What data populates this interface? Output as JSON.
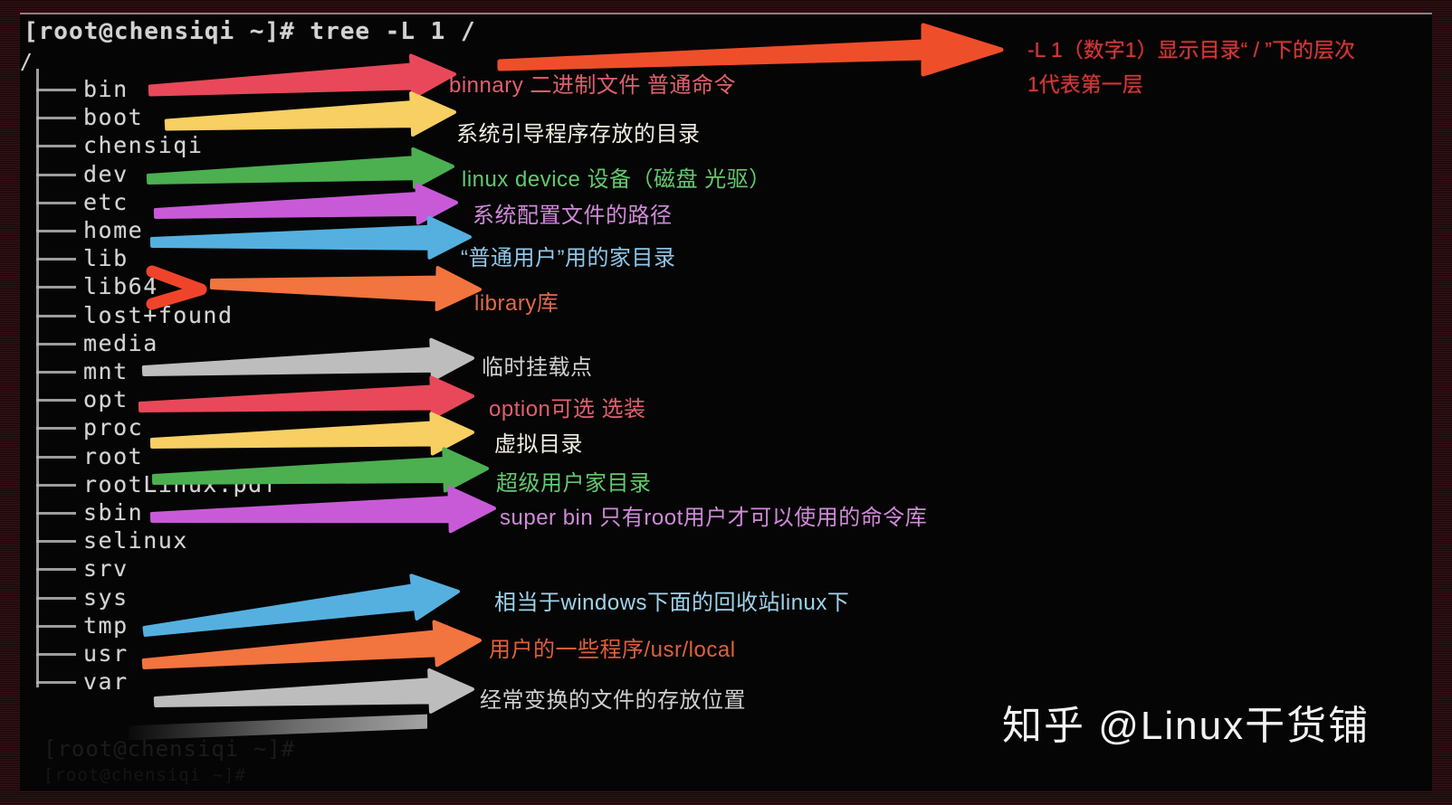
{
  "terminal": {
    "prompt": "[root@chensiqi ~]# tree -L 1 /",
    "root": "/",
    "ghost_line_1": "[root@chensiqi ~]#",
    "ghost_line_2": "[root@chensiqi ~]#"
  },
  "tree": {
    "entries": [
      {
        "name": "bin",
        "note": "binnary 二进制文件 普通命令",
        "color": "#e8485a"
      },
      {
        "name": "boot",
        "note": "系统引导程序存放的目录",
        "color": "#f7cf62"
      },
      {
        "name": "chensiqi",
        "note": "",
        "color": ""
      },
      {
        "name": "dev",
        "note": "linux device 设备（磁盘 光驱）",
        "color": "#4caf50"
      },
      {
        "name": "etc",
        "note": "系统配置文件的路径",
        "color": "#c85ad8"
      },
      {
        "name": "home",
        "note": "“普通用户”用的家目录",
        "color": "#55b0e0"
      },
      {
        "name": "lib",
        "note": "",
        "color": "#f05a32"
      },
      {
        "name": "lib64",
        "note": "library库",
        "color": "#f2743f"
      },
      {
        "name": "lost+found",
        "note": "",
        "color": ""
      },
      {
        "name": "media",
        "note": "",
        "color": ""
      },
      {
        "name": "mnt",
        "note": "临时挂载点",
        "color": "#bdbdbd"
      },
      {
        "name": "opt",
        "note": "option可选 选装",
        "color": "#e8485a"
      },
      {
        "name": "proc",
        "note": "虚拟目录",
        "color": "#f7cf62"
      },
      {
        "name": "root",
        "note": "超级用户家目录",
        "color": "#4caf50"
      },
      {
        "name": "rootLinux.pdf",
        "note": "",
        "color": ""
      },
      {
        "name": "sbin",
        "note": "super bin 只有root用户才可以使用的命令库",
        "color": "#c85ad8"
      },
      {
        "name": "selinux",
        "note": "",
        "color": ""
      },
      {
        "name": "srv",
        "note": "",
        "color": ""
      },
      {
        "name": "sys",
        "note": "",
        "color": ""
      },
      {
        "name": "tmp",
        "note": "相当于windows下面的回收站linux下",
        "color": "#55b0e0"
      },
      {
        "name": "usr",
        "note": "用户的一些程序/usr/local",
        "color": "#f2743f"
      },
      {
        "name": "var",
        "note": "经常变换的文件的存放位置",
        "color": "#bdbdbd"
      }
    ]
  },
  "notes": {
    "bin": "binnary 二进制文件 普通命令",
    "boot": "系统引导程序存放的目录",
    "dev": "linux device 设备（磁盘 光驱）",
    "etc": "系统配置文件的路径",
    "home": "“普通用户”用的家目录",
    "lib": "library库",
    "mnt": "临时挂载点",
    "opt": "option可选 选装",
    "proc": "虚拟目录",
    "root": "超级用户家目录",
    "sbin": "super bin 只有root用户才可以使用的命令库",
    "tmp": "相当于windows下面的回收站linux下",
    "usr": "用户的一些程序/usr/local",
    "var": "经常变换的文件的存放位置"
  },
  "hint": "-L 1（数字1）显示目录“ / ”下的层次\n1代表第一层",
  "watermark": "知乎 @Linux干货铺",
  "colors": {
    "red": "#e8485a",
    "orange_red": "#ef4e2a",
    "yellow": "#f7cf62",
    "green": "#4caf50",
    "magenta": "#c85ad8",
    "blue": "#55b0e0",
    "orange": "#f2743f",
    "gray": "#bdbdbd",
    "terminal_text": "#d4d4d4",
    "hint_red": "#d03a3a",
    "background": "#050505",
    "frame": "#2a0d10"
  }
}
